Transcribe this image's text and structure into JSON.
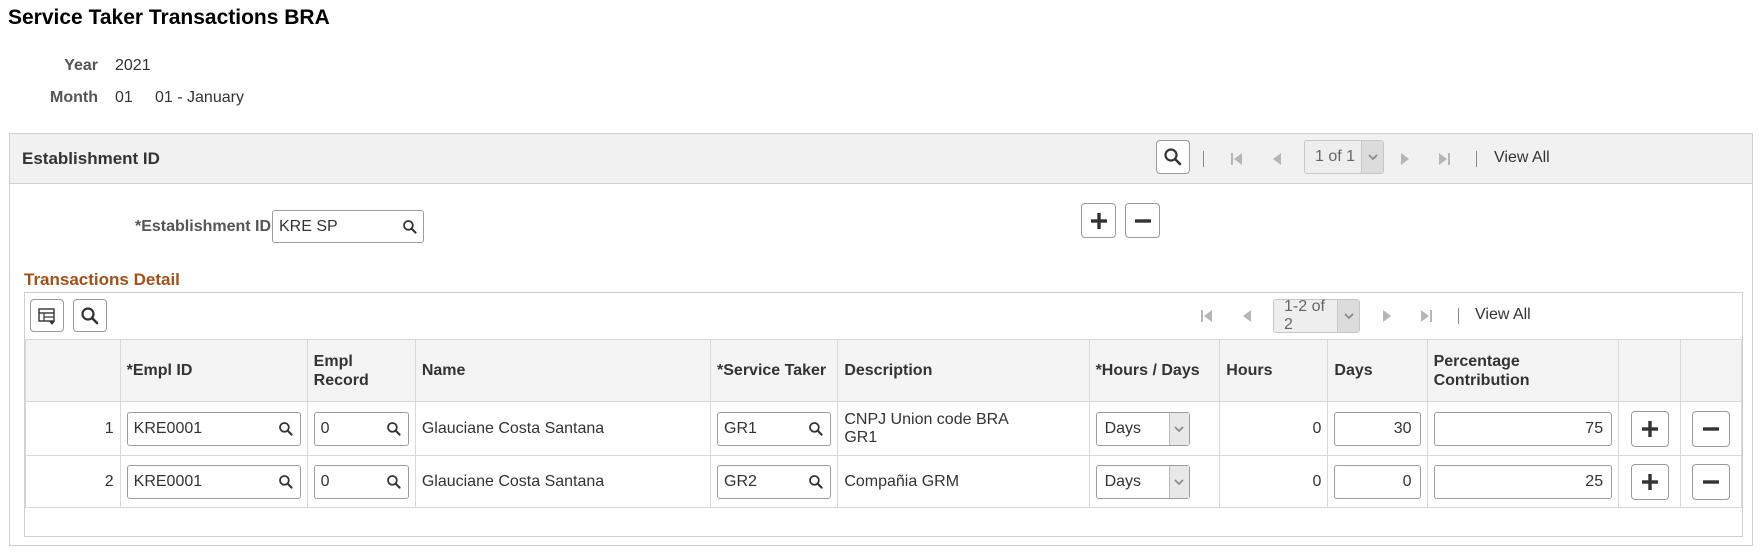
{
  "page": {
    "title": "Service Taker Transactions BRA"
  },
  "header_fields": {
    "year_label": "Year",
    "year_value": "2021",
    "month_label": "Month",
    "month_value": "01",
    "month_desc": "01 - January"
  },
  "establishment": {
    "group_title": "Establishment ID",
    "pager_text": "1 of 1",
    "view_all": "View All",
    "field_label": "*Establishment ID",
    "field_value": "KRE SP"
  },
  "transactions": {
    "title": "Transactions Detail",
    "pager_text": "1-2 of 2",
    "view_all": "View All",
    "columns": [
      "",
      "*Empl ID",
      "Empl Record",
      "Name",
      "*Service Taker",
      "Description",
      "*Hours / Days",
      "Hours",
      "Days",
      "Percentage Contribution",
      "",
      ""
    ],
    "rows": [
      {
        "num": "1",
        "empl_id": "KRE0001",
        "empl_record": "0",
        "name": "Glauciane Costa Santana",
        "service_taker": "GR1",
        "description_line1": "CNPJ Union code BRA",
        "description_line2": "GR1",
        "hours_days": "Days",
        "hours": "0",
        "days": "30",
        "percentage": "75"
      },
      {
        "num": "2",
        "empl_id": "KRE0001",
        "empl_record": "0",
        "name": "Glauciane Costa Santana",
        "service_taker": "GR2",
        "description_line1": "Compañia GRM",
        "description_line2": "",
        "hours_days": "Days",
        "hours": "0",
        "days": "0",
        "percentage": "25"
      }
    ]
  },
  "icons": {
    "search": "search-icon",
    "first": "first-page-icon",
    "prev": "previous-page-icon",
    "next": "next-page-icon",
    "last": "last-page-icon",
    "add": "plus-icon",
    "remove": "minus-icon",
    "personalize": "grid-personalize-icon",
    "dropdown": "chevron-down-icon"
  },
  "colors": {
    "section_title": "#a0521a",
    "header_bg": "#f1f1f1"
  }
}
